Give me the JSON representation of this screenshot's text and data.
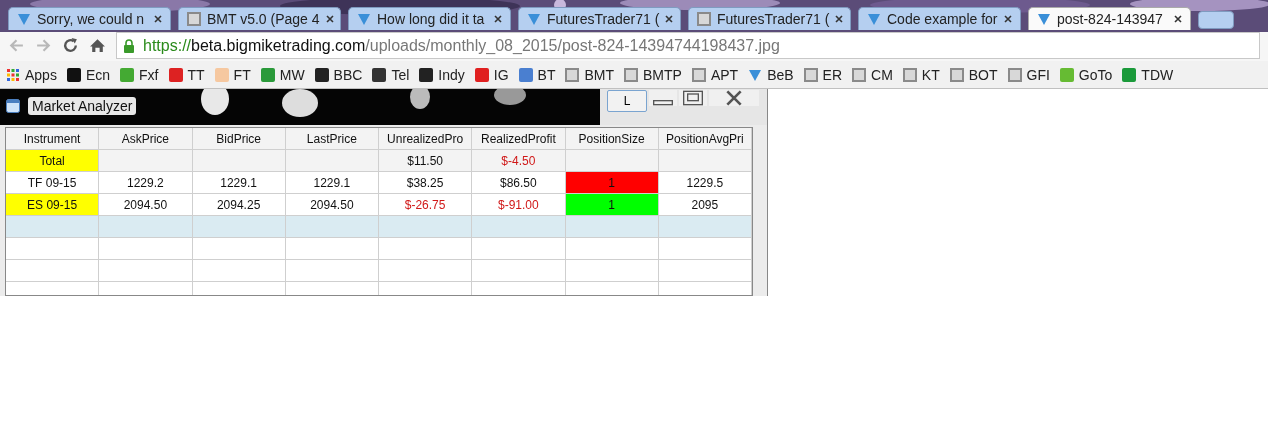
{
  "tabs": [
    {
      "title": "Sorry, we could n",
      "kind": "chevron",
      "selected": false
    },
    {
      "title": "BMT v5.0 (Page 4",
      "kind": "bm",
      "selected": false
    },
    {
      "title": "How long did it ta",
      "kind": "chevron",
      "selected": false
    },
    {
      "title": "FuturesTrader71 (",
      "kind": "chevron",
      "selected": false
    },
    {
      "title": "FuturesTrader71 (",
      "kind": "bm",
      "selected": false
    },
    {
      "title": "Code example for",
      "kind": "chevron",
      "selected": false
    },
    {
      "title": "post-824-143947",
      "kind": "chevron",
      "selected": true
    }
  ],
  "address": {
    "scheme": "https://",
    "host": "beta.bigmiketrading.com",
    "path": "/uploads/monthly_08_2015/post-824-14394744198437.jpg"
  },
  "bookmarks": [
    {
      "label": "Apps",
      "kind": "apps"
    },
    {
      "label": "Ecn",
      "kind": "square",
      "color": "#111111"
    },
    {
      "label": "Fxf",
      "kind": "square",
      "color": "#44aa33"
    },
    {
      "label": "TT",
      "kind": "square",
      "color": "#dd2222"
    },
    {
      "label": "FT",
      "kind": "square",
      "color": "#f6c8a0"
    },
    {
      "label": "MW",
      "kind": "square",
      "color": "#2a9a3a"
    },
    {
      "label": "BBC",
      "kind": "square",
      "color": "#222222"
    },
    {
      "label": "Tel",
      "kind": "square",
      "color": "#333333"
    },
    {
      "label": "Indy",
      "kind": "square",
      "color": "#222222"
    },
    {
      "label": "IG",
      "kind": "square",
      "color": "#e02020"
    },
    {
      "label": "BT",
      "kind": "square",
      "color": "#4a7fd0"
    },
    {
      "label": "BMT",
      "kind": "bm"
    },
    {
      "label": "BMTP",
      "kind": "bm"
    },
    {
      "label": "APT",
      "kind": "bm"
    },
    {
      "label": "BeB",
      "kind": "chevron"
    },
    {
      "label": "ER",
      "kind": "bm"
    },
    {
      "label": "CM",
      "kind": "bm"
    },
    {
      "label": "KT",
      "kind": "bm"
    },
    {
      "label": "BOT",
      "kind": "bm"
    },
    {
      "label": "GFI",
      "kind": "bm"
    },
    {
      "label": "GoTo",
      "kind": "square",
      "color": "#66bb33"
    },
    {
      "label": "TDW",
      "kind": "square",
      "color": "#1a9a3a"
    }
  ],
  "window": {
    "title": "Market Analyzer",
    "button": "L"
  },
  "table": {
    "columns": [
      "Instrument",
      "AskPrice",
      "BidPrice",
      "LastPrice",
      "UnrealizedPro",
      "RealizedProfit",
      "PositionSize",
      "PositionAvgPri"
    ],
    "rows": [
      {
        "selected": false,
        "cells": [
          {
            "text": "Total",
            "color": "#ffff00"
          },
          {},
          {},
          {},
          {
            "text": "$11.50"
          },
          {
            "text": "$-4.50",
            "negative": true
          },
          {},
          {}
        ]
      },
      {
        "selected": false,
        "cells": [
          {
            "text": "TF 09-15"
          },
          {
            "text": "1229.2"
          },
          {
            "text": "1229.1"
          },
          {
            "text": "1229.1"
          },
          {
            "text": "$38.25"
          },
          {
            "text": "$86.50"
          },
          {
            "text": "1",
            "color": "#ff0000"
          },
          {
            "text": "1229.5"
          }
        ]
      },
      {
        "selected": false,
        "cells": [
          {
            "text": "ES 09-15",
            "color": "#ffff00"
          },
          {
            "text": "2094.50"
          },
          {
            "text": "2094.25"
          },
          {
            "text": "2094.50"
          },
          {
            "text": "$-26.75",
            "negative": true
          },
          {
            "text": "$-91.00",
            "negative": true
          },
          {
            "text": "1",
            "color": "#00ff00"
          },
          {
            "text": "2095"
          }
        ]
      },
      {
        "selected": true
      },
      {
        "selected": false
      },
      {
        "selected": false
      },
      {
        "selected": false
      }
    ]
  }
}
